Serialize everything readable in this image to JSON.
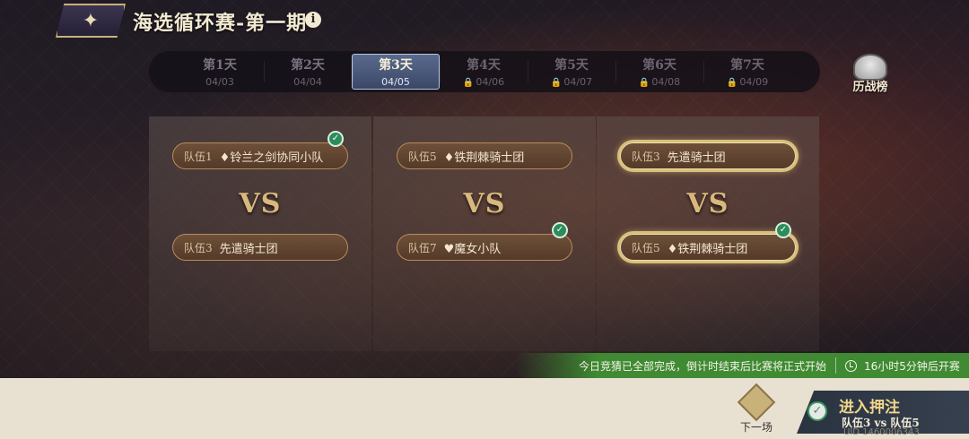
{
  "header": {
    "back_icon": "back-arrow-icon",
    "title": "海选循环赛-第一期",
    "info_icon": "i"
  },
  "days": [
    {
      "name": "第1天",
      "date": "04/03",
      "state": "past"
    },
    {
      "name": "第2天",
      "date": "04/04",
      "state": "past"
    },
    {
      "name": "第3天",
      "date": "04/05",
      "state": "active"
    },
    {
      "name": "第4天",
      "date": "04/06",
      "state": "locked"
    },
    {
      "name": "第5天",
      "date": "04/07",
      "state": "locked"
    },
    {
      "name": "第6天",
      "date": "04/08",
      "state": "locked"
    },
    {
      "name": "第7天",
      "date": "04/09",
      "state": "locked"
    }
  ],
  "history": {
    "label": "历战榜"
  },
  "vs_label": "VS",
  "matches": [
    {
      "top": {
        "tag": "队伍1",
        "name": "♦铃兰之剑协同小队",
        "winner": true
      },
      "bottom": {
        "tag": "队伍3",
        "name": "先遣骑士团",
        "winner": false
      }
    },
    {
      "top": {
        "tag": "队伍5",
        "name": "♦铁荆棘骑士团",
        "winner": false
      },
      "bottom": {
        "tag": "队伍7",
        "name": "♥魔女小队",
        "winner": true
      }
    },
    {
      "top": {
        "tag": "队伍3",
        "name": "先遣骑士团",
        "winner": false
      },
      "bottom": {
        "tag": "队伍5",
        "name": "♦铁荆棘骑士团",
        "winner": true
      }
    }
  ],
  "notice": {
    "message": "今日竞猜已全部完成，倒计时结束后比赛将正式开始",
    "countdown": "16小时5分钟后开赛"
  },
  "next_match": {
    "label": "下一场"
  },
  "bet": {
    "title": "进入押注",
    "subtitle": "队伍3 vs 队伍5"
  },
  "uid": "UID 1460006343"
}
